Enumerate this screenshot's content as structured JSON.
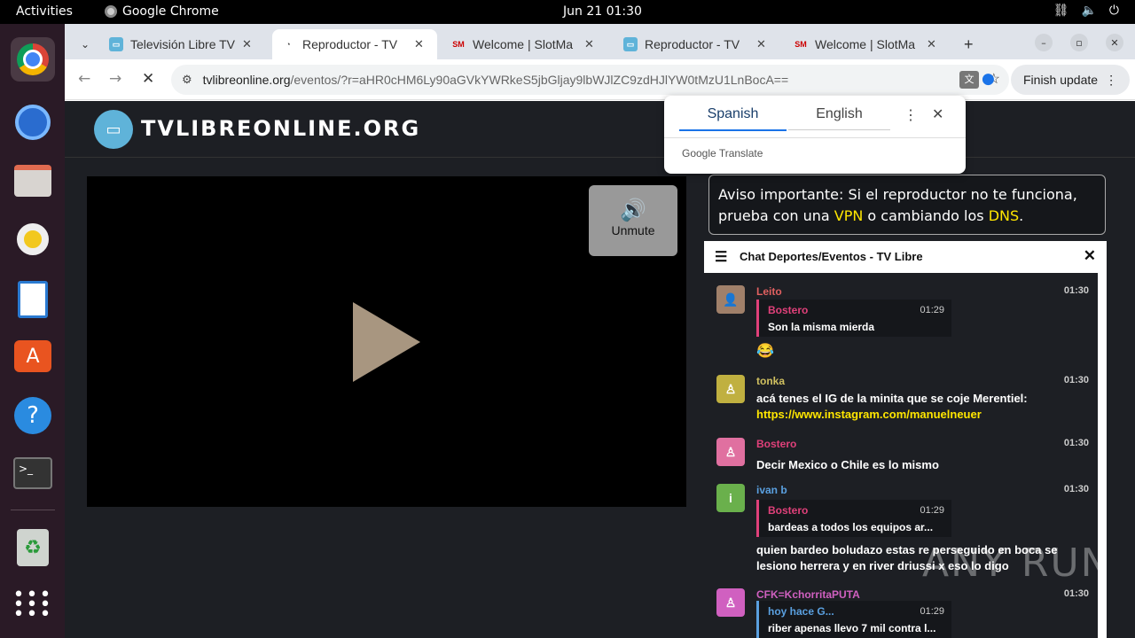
{
  "topbar": {
    "activities": "Activities",
    "app_name": "Google Chrome",
    "clock": "Jun 21  01:30",
    "sys_icons": [
      "network-icon",
      "volume-icon",
      "power-icon"
    ]
  },
  "dock": {
    "items": [
      "chrome-icon",
      "thunderbird-icon",
      "files-icon",
      "rhythmbox-icon",
      "writer-icon",
      "app-center-icon",
      "help-icon",
      "terminal-icon",
      "trash-icon",
      "app-grid-icon"
    ]
  },
  "tabs": [
    {
      "title": "Televisión Libre TV",
      "icon": "tvlibre-icon"
    },
    {
      "title": "Reproductor - TV",
      "icon": "loading-icon",
      "active": true
    },
    {
      "title": "Welcome | SlotMa",
      "icon": "slotmania-icon"
    },
    {
      "title": "Reproductor - TV",
      "icon": "tvlibre-icon"
    },
    {
      "title": "Welcome | SlotMa",
      "icon": "slotmania-icon"
    }
  ],
  "toolbar": {
    "url_domain": "tvlibreonline.org",
    "url_path": "/eventos/?r=aHR0cHM6Ly90aGVkYWRkeS5jbGljay9lbWJlZC9zdHJlYW0tMzU1LnBocA==",
    "finish_update": "Finish update"
  },
  "site": {
    "title": "TVLIBREONLINE.ORG"
  },
  "player": {
    "unmute_label": "Unmute"
  },
  "notice": {
    "text_before": "Aviso importante: Si el reproductor no te funciona, prueba con una ",
    "vpn": "VPN",
    "text_middle": " o cambiando los ",
    "dns": "DNS",
    "text_after": "."
  },
  "translate_popup": {
    "tab_source": "Spanish",
    "tab_target": "English",
    "brand": "Google Translate"
  },
  "chat": {
    "title": "Chat Deportes/Eventos - TV Libre",
    "messages": [
      {
        "user": "Leito",
        "time": "01:30",
        "quote_user": "Bostero",
        "quote_time": "01:29",
        "quote_text": "Son la misma mierda",
        "text": "😂"
      },
      {
        "user": "tonka",
        "time": "01:30",
        "text": "acá tenes el IG de la minita que se coje Merentiel:",
        "link": "https://www.instagram.com/manuelneuer"
      },
      {
        "user": "Bostero",
        "time": "01:30",
        "text": "Decir Mexico o Chile es lo mismo"
      },
      {
        "user": "ivan b",
        "time": "01:30",
        "avatar_letter": "i",
        "quote_user": "Bostero",
        "quote_time": "01:29",
        "quote_text": "bardeas a todos los equipos ar...",
        "text": "quien bardeo boludazo estas re perseguido en boca se lesiono herrera y en river driussi x eso lo digo"
      },
      {
        "user": "CFK=KchorritaPUTA",
        "time": "01:30",
        "quote_user": "hoy hace G...",
        "quote_time": "01:29",
        "quote_text": "riber apenas llevo 7 mil contra l..."
      }
    ]
  },
  "watermark": "ANY RUN"
}
